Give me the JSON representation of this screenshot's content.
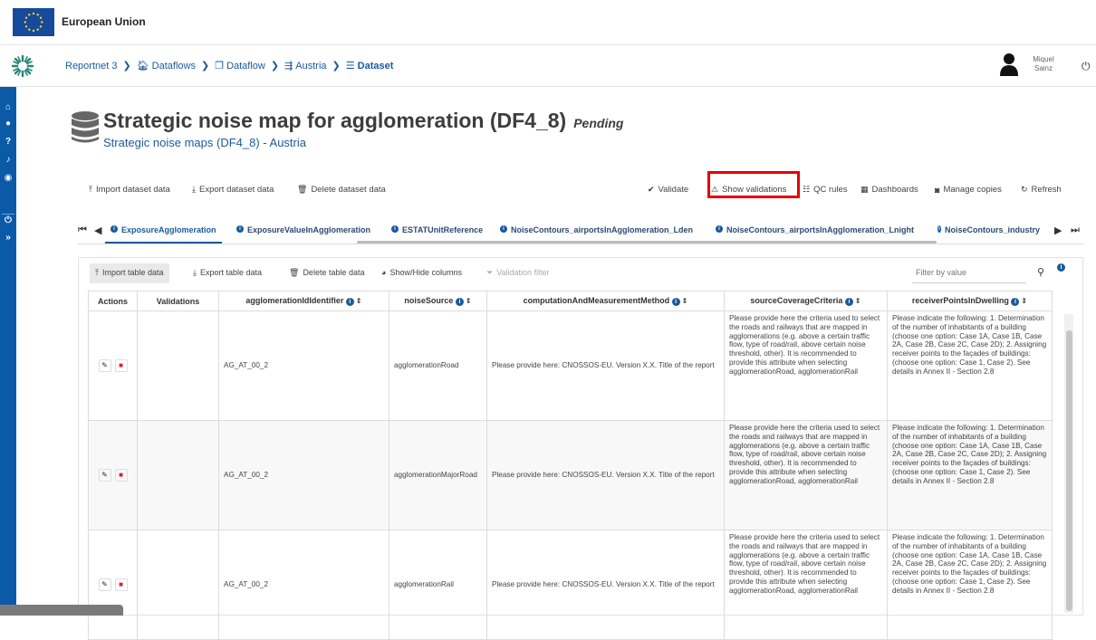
{
  "eu_bar": {
    "label": "European Union"
  },
  "breadcrumb": [
    {
      "label": "Reportnet 3",
      "icon": "none"
    },
    {
      "label": "Dataflows",
      "icon": "home-icon"
    },
    {
      "label": "Dataflow",
      "icon": "clone-icon"
    },
    {
      "label": "Austria",
      "icon": "dataflow-icon"
    },
    {
      "label": "Dataset",
      "icon": "database-icon"
    }
  ],
  "user": {
    "first": "Miquel",
    "last": "Sainz"
  },
  "page": {
    "title": "Strategic noise map for agglomeration (DF4_8)",
    "status": "Pending",
    "subtitle": "Strategic noise maps (DF4_8) - Austria"
  },
  "dataset_toolbar": {
    "import": "Import dataset data",
    "export": "Export dataset data",
    "delete": "Delete dataset data",
    "validate": "Validate",
    "show_validations": "Show validations",
    "qc_rules": "QC rules",
    "dashboards": "Dashboards",
    "manage_copies": "Manage copies",
    "refresh": "Refresh"
  },
  "tabs": [
    "ExposureAgglomeration",
    "ExposureValueInAgglomeration",
    "ESTATUnitReference",
    "NoiseContours_airportsInAgglomeration_Lden",
    "NoiseContours_airportsInAgglomeration_Lnight",
    "NoiseContours_industry"
  ],
  "table_toolbar": {
    "import": "Import table data",
    "export": "Export table data",
    "delete": "Delete table data",
    "show_hide": "Show/Hide columns",
    "validation_filter": "Validation filter",
    "filter_placeholder": "Filter by value"
  },
  "columns": {
    "actions": "Actions",
    "validations": "Validations",
    "agglomerationIdIdentifier": "agglomerationIdIdentifier",
    "noiseSource": "noiseSource",
    "computationAndMeasurementMethod": "computationAndMeasurementMethod",
    "sourceCoverageCriteria": "sourceCoverageCriteria",
    "receiverPointsInDwelling": "receiverPointsInDwelling"
  },
  "rows": [
    {
      "id": "AG_AT_00_2",
      "noiseSource": "agglomerationRoad",
      "method": "Please provide here: CNOSSOS-EU. Version X.X. Title of the report",
      "coverage": "Please provide here the criteria used to select the roads and railways that are mapped in agglomerations (e.g. above a certain traffic flow, type of road/rail, above certain noise threshold, other). It is recommended to provide this attribute when selecting agglomerationRoad, agglomerationRail",
      "receiver": "Please indicate the following: 1. Determination of the number of inhabitants of a building (choose one option: Case 1A, Case 1B, Case 2A, Case 2B, Case 2C, Case 2D); 2. Assigning receiver points to the façades of buildings:(choose one option: Case 1, Case 2). See details in Annex II - Section 2.8"
    },
    {
      "id": "AG_AT_00_2",
      "noiseSource": "agglomerationMajorRoad",
      "method": "Please provide here: CNOSSOS-EU. Version X.X. Title of the report",
      "coverage": "Please provide here the criteria used to select the roads and railways that are mapped in agglomerations (e.g. above a certain traffic flow, type of road/rail, above certain noise threshold, other). It is recommended to provide this attribute when selecting agglomerationRoad, agglomerationRail",
      "receiver": "Please indicate the following: 1. Determination of the number of inhabitants of a building (choose one option: Case 1A, Case 1B, Case 2A, Case 2B, Case 2C, Case 2D); 2. Assigning receiver points to the façades of buildings:(choose one option: Case 1, Case 2). See details in Annex II - Section 2.8"
    },
    {
      "id": "AG_AT_00_2",
      "noiseSource": "agglomerationRail",
      "method": "Please provide here: CNOSSOS-EU. Version X.X. Title of the report",
      "coverage": "Please provide here the criteria used to select the roads and railways that are mapped in agglomerations (e.g. above a certain traffic flow, type of road/rail, above certain noise threshold, other). It is recommended to provide this attribute when selecting agglomerationRoad, agglomerationRail",
      "receiver": "Please indicate the following: 1. Determination of the number of inhabitants of a building (choose one option: Case 1A, Case 1B, Case 2A, Case 2B, Case 2C, Case 2D); 2. Assigning receiver points to the façades of buildings:(choose one option: Case 1, Case 2). See details in Annex II - Section 2.8"
    }
  ],
  "colors": {
    "primary": "#1a5a9c",
    "sidebar": "#0a5aa8",
    "highlight": "#e60000",
    "delete": "#d9202a"
  }
}
